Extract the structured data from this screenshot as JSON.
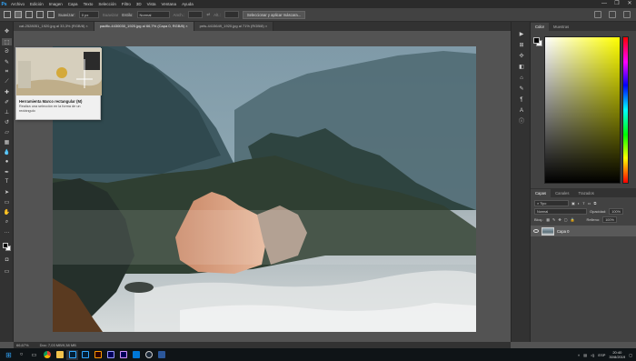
{
  "app": {
    "logo": "Ps"
  },
  "menu": [
    "Archivo",
    "Edición",
    "Imagen",
    "Capa",
    "Texto",
    "Selección",
    "Filtro",
    "3D",
    "Vista",
    "Ventana",
    "Ayuda"
  ],
  "window_controls": [
    "—",
    "❐",
    "✕"
  ],
  "options": {
    "suavizar_label": "Suavizar:",
    "suavizar_value": "0 px",
    "suavizar_aa": "Suavizar",
    "estilo_label": "Estilo:",
    "estilo_value": "Normal",
    "anchura_label": "Anch.:",
    "altura_label": "Alt.:",
    "select_mask_button": "Seleccionar y aplicar máscara..."
  },
  "tabs": [
    {
      "label": "cat-2528051_1920.jpg al 33,3% (RGB/8) ×",
      "active": false
    },
    {
      "label": "pacific-4430030_1920.jpg al 66,7% (Capa 0, RGB/8) ×",
      "active": true
    },
    {
      "label": "pets-4415649_1920.jpg al 71% (RGB/8) ×",
      "active": false
    }
  ],
  "tooltip": {
    "title": "Herramienta Marco rectangular (M)",
    "description": "Realiza una selección en la forma de un rectángulo"
  },
  "status": {
    "zoom": "66,67%",
    "doc": "Doc: 7,03 MB/9,38 MB"
  },
  "panels": {
    "color_tabs": [
      "Color",
      "Muestras"
    ],
    "layers_tabs": [
      "Capas",
      "Canales",
      "Trazados"
    ],
    "kind_label": "Tipo",
    "blend_mode": "Normal",
    "opacity_label": "Opacidad:",
    "opacity_value": "100%",
    "lock_label": "Bloq.:",
    "fill_label": "Relleno:",
    "fill_value": "100%",
    "layer_name": "Capa 0"
  },
  "taskbar": {
    "time": "20:40",
    "date": "30/8/2019",
    "lang": "ESP",
    "icons": [
      "windows-icon",
      "search-icon",
      "taskview-icon",
      "chrome-icon",
      "folder-icon",
      "photoshop-icon",
      "lightroom-icon",
      "illustrator-icon",
      "premiere-icon",
      "aftereffects-icon",
      "vscode-icon",
      "steam-icon",
      "word-icon"
    ]
  },
  "colors": {
    "accent": "#31a8ff",
    "workspace": "#535353",
    "panel": "#424242",
    "dark": "#323232"
  }
}
